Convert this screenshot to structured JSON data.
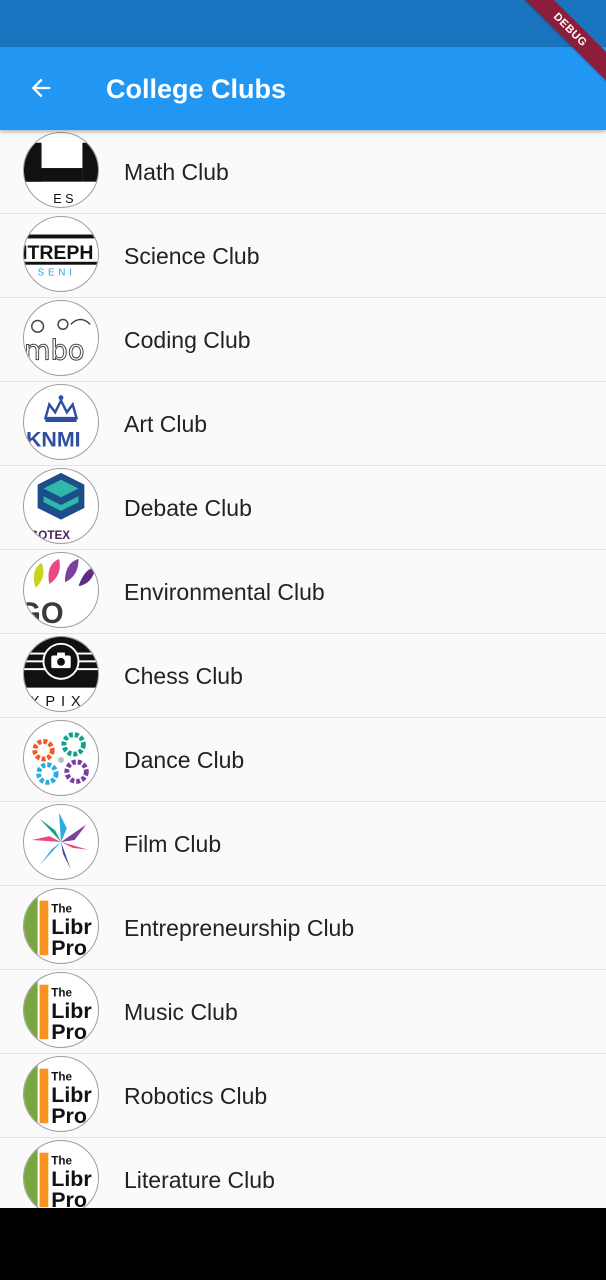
{
  "app_bar": {
    "title": "College Clubs",
    "back_icon": "arrow-back-icon"
  },
  "debug_banner": {
    "label": "DEBUG"
  },
  "colors": {
    "app_bar": "#2196f3",
    "status_bar": "#1b74bf",
    "debug": "#8d1e3b"
  },
  "clubs": [
    {
      "name": "Math Club",
      "logo": "logo-es-icon",
      "logo_text": "E S"
    },
    {
      "name": "Science Club",
      "logo": "logo-itreph-icon",
      "logo_text": "ITREPH"
    },
    {
      "name": "Coding Club",
      "logo": "logo-mbo-icon",
      "logo_text": "mbo"
    },
    {
      "name": "Art Club",
      "logo": "logo-knmi-crown-icon",
      "logo_text": "KNMI"
    },
    {
      "name": "Debate Club",
      "logo": "logo-ogotex-icon",
      "logo_text": "OGOTEX"
    },
    {
      "name": "Environmental Club",
      "logo": "logo-ngo-leaves-icon",
      "logo_text": "GO"
    },
    {
      "name": "Chess Club",
      "logo": "logo-camera-icon",
      "logo_text": "XPIX"
    },
    {
      "name": "Dance Club",
      "logo": "logo-gears-icon"
    },
    {
      "name": "Film Club",
      "logo": "logo-flower-icon"
    },
    {
      "name": "Entrepreneurship Club",
      "logo": "logo-library-icon",
      "logo_text": "The Libr Pro"
    },
    {
      "name": "Music Club",
      "logo": "logo-library-icon",
      "logo_text": "The Libr Pro"
    },
    {
      "name": "Robotics Club",
      "logo": "logo-library-icon",
      "logo_text": "The Libr Pro"
    },
    {
      "name": "Literature Club",
      "logo": "logo-library-icon",
      "logo_text": "The Libr Pro"
    }
  ]
}
